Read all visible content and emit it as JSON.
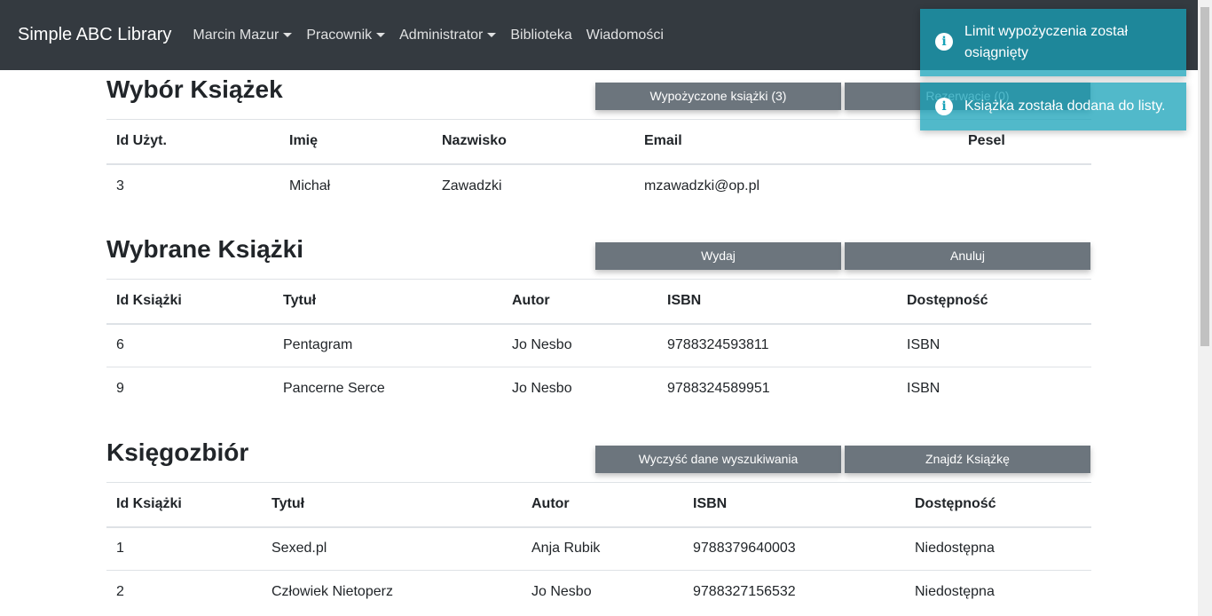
{
  "navbar": {
    "brand": "Simple ABC Library",
    "items": [
      {
        "label": "Marcin Mazur",
        "dropdown": true
      },
      {
        "label": "Pracownik",
        "dropdown": true
      },
      {
        "label": "Administrator",
        "dropdown": true
      },
      {
        "label": "Biblioteka",
        "dropdown": false
      },
      {
        "label": "Wiadomości",
        "dropdown": false
      }
    ]
  },
  "selection": {
    "title": "Wybór Książek",
    "btn_left": "Wypożyczone książki (3)",
    "btn_right": "Rezerwacje (0)",
    "columns": [
      "Id Użyt.",
      "Imię",
      "Nazwisko",
      "Email",
      "Pesel"
    ],
    "rows": [
      [
        "3",
        "Michał",
        "Zawadzki",
        "mzawadzki@op.pl",
        ""
      ]
    ]
  },
  "chosen": {
    "title": "Wybrane Książki",
    "btn_left": "Wydaj",
    "btn_right": "Anuluj",
    "columns": [
      "Id Książki",
      "Tytuł",
      "Autor",
      "ISBN",
      "Dostępność"
    ],
    "rows": [
      [
        "6",
        "Pentagram",
        "Jo Nesbo",
        "9788324593811",
        "ISBN"
      ],
      [
        "9",
        "Pancerne Serce",
        "Jo Nesbo",
        "9788324589951",
        "ISBN"
      ]
    ]
  },
  "collection": {
    "title": "Księgozbiór",
    "btn_left": "Wyczyść dane wyszukiwania",
    "btn_right": "Znajdź Książkę",
    "columns": [
      "Id Książki",
      "Tytuł",
      "Autor",
      "ISBN",
      "Dostępność"
    ],
    "rows": [
      [
        "1",
        "Sexed.pl",
        "Anja Rubik",
        "9788379640003",
        "Niedostępna"
      ],
      [
        "2",
        "Człowiek Nietoperz",
        "Jo Nesbo",
        "9788327156532",
        "Niedostępna"
      ]
    ]
  },
  "toasts": [
    {
      "icon": "info-icon",
      "text": "Limit wypożyczenia został osiągnięty"
    },
    {
      "icon": "info-icon",
      "text": "Książka została dodana do listy."
    }
  ],
  "colors": {
    "navbar": "#343a40",
    "button": "#6c757d",
    "toast": "#17a2b8"
  }
}
